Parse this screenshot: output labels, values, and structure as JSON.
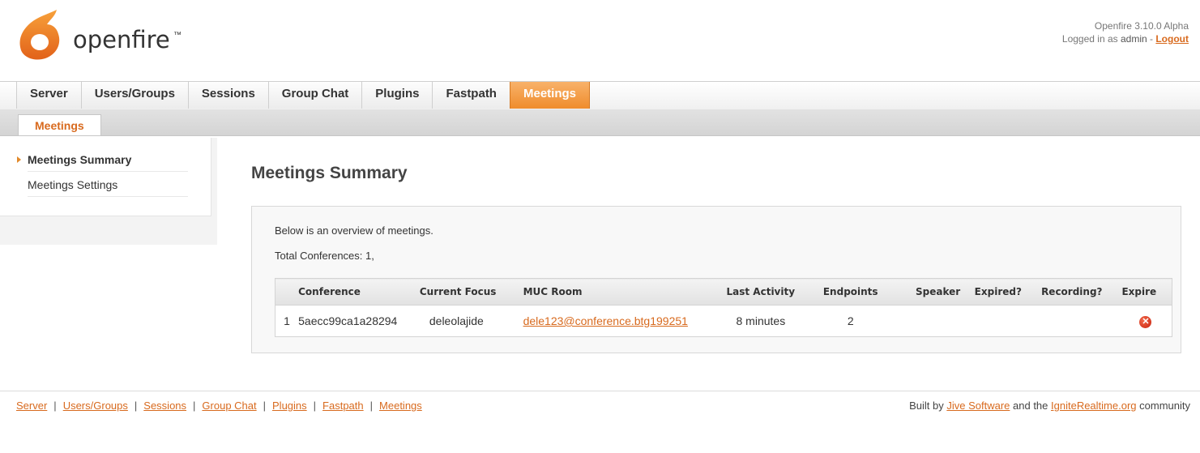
{
  "header": {
    "logo_text": "openfire",
    "logo_tm": "™",
    "version": "Openfire 3.10.0 Alpha",
    "logged_in_prefix": "Logged in as",
    "username": "admin",
    "separator": " - ",
    "logout_label": "Logout"
  },
  "main_nav": {
    "tabs": [
      {
        "label": "Server"
      },
      {
        "label": "Users/Groups"
      },
      {
        "label": "Sessions"
      },
      {
        "label": "Group Chat"
      },
      {
        "label": "Plugins"
      },
      {
        "label": "Fastpath"
      },
      {
        "label": "Meetings",
        "active": true
      }
    ]
  },
  "sub_nav": {
    "tab": "Meetings"
  },
  "sidebar": {
    "items": [
      {
        "label": "Meetings Summary",
        "active": true
      },
      {
        "label": "Meetings Settings"
      }
    ]
  },
  "main": {
    "title": "Meetings Summary",
    "overview_text": "Below is an overview of meetings.",
    "total_text": "Total Conferences: 1,",
    "table": {
      "headers": [
        "",
        "Conference",
        "Current Focus",
        "MUC Room",
        "Last Activity",
        "Endpoints",
        "Speaker",
        "Expired?",
        "Recording?",
        "Expire"
      ],
      "rows": [
        {
          "num": "1",
          "conference": "5aecc99ca1a28294",
          "focus": "deleolajide",
          "muc_room": "dele123@conference.btg199251",
          "last_activity": "8 minutes",
          "endpoints": "2",
          "speaker": "",
          "expired": "",
          "recording": "",
          "expire_icon": "delete-x-icon"
        }
      ]
    }
  },
  "footer": {
    "links": [
      "Server",
      "Users/Groups",
      "Sessions",
      "Group Chat",
      "Plugins",
      "Fastpath",
      "Meetings"
    ],
    "separator": "|",
    "credit_prefix": "Built by",
    "credit_link1": "Jive Software",
    "credit_middle": "and the",
    "credit_link2": "IgniteRealtime.org",
    "credit_suffix": "community"
  },
  "colors": {
    "accent": "#d86a1e",
    "active_tab": "#ef8c2c"
  }
}
